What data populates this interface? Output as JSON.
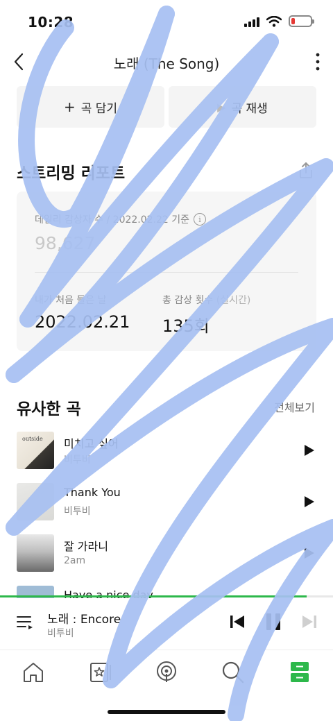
{
  "status_bar": {
    "time": "10:28",
    "battery_level": 0.12
  },
  "nav": {
    "title": "노래 (The Song)",
    "back_icon": "chevron-left-icon",
    "more_icon": "more-vertical-icon"
  },
  "actions": {
    "add_label": "곡 담기",
    "add_icon": "plus-icon",
    "play_label": "곡 재생",
    "play_icon": "play-icon"
  },
  "streaming_report": {
    "title": "스트리밍 리포트",
    "share_icon": "share-icon",
    "daily_listeners_label": "데일리 감상자 수 / 2022.02.22 기준",
    "daily_listeners_value": "98,627",
    "first_listen_label": "내가 처음 들은 날",
    "first_listen_value": "2022.02.21",
    "total_plays_label": "총 감상 횟수",
    "total_plays_sub": "(실시간)",
    "total_plays_value": "135회"
  },
  "similar": {
    "title": "유사한 곡",
    "view_all": "전체보기",
    "songs": [
      {
        "title": "미치고 싶어",
        "artist": "비투비",
        "album_text": "outside"
      },
      {
        "title": "Thank You",
        "artist": "비투비"
      },
      {
        "title": "잘 가라니",
        "artist": "2am"
      },
      {
        "title": "Have a nice day",
        "artist": ""
      }
    ]
  },
  "now_playing": {
    "title": "노래 : Encore",
    "artist": "비투비",
    "progress": 0.92,
    "icons": [
      "queue-icon",
      "previous-icon",
      "pause-icon",
      "next-icon"
    ]
  },
  "tabs": [
    {
      "name": "home",
      "icon": "home-icon"
    },
    {
      "name": "storage",
      "icon": "library-icon"
    },
    {
      "name": "radio",
      "icon": "podcast-icon"
    },
    {
      "name": "search",
      "icon": "search-icon"
    },
    {
      "name": "player",
      "icon": "player-icon",
      "active": true
    }
  ],
  "colors": {
    "accent": "#2db84b",
    "scribble": "#a7c0f2"
  }
}
